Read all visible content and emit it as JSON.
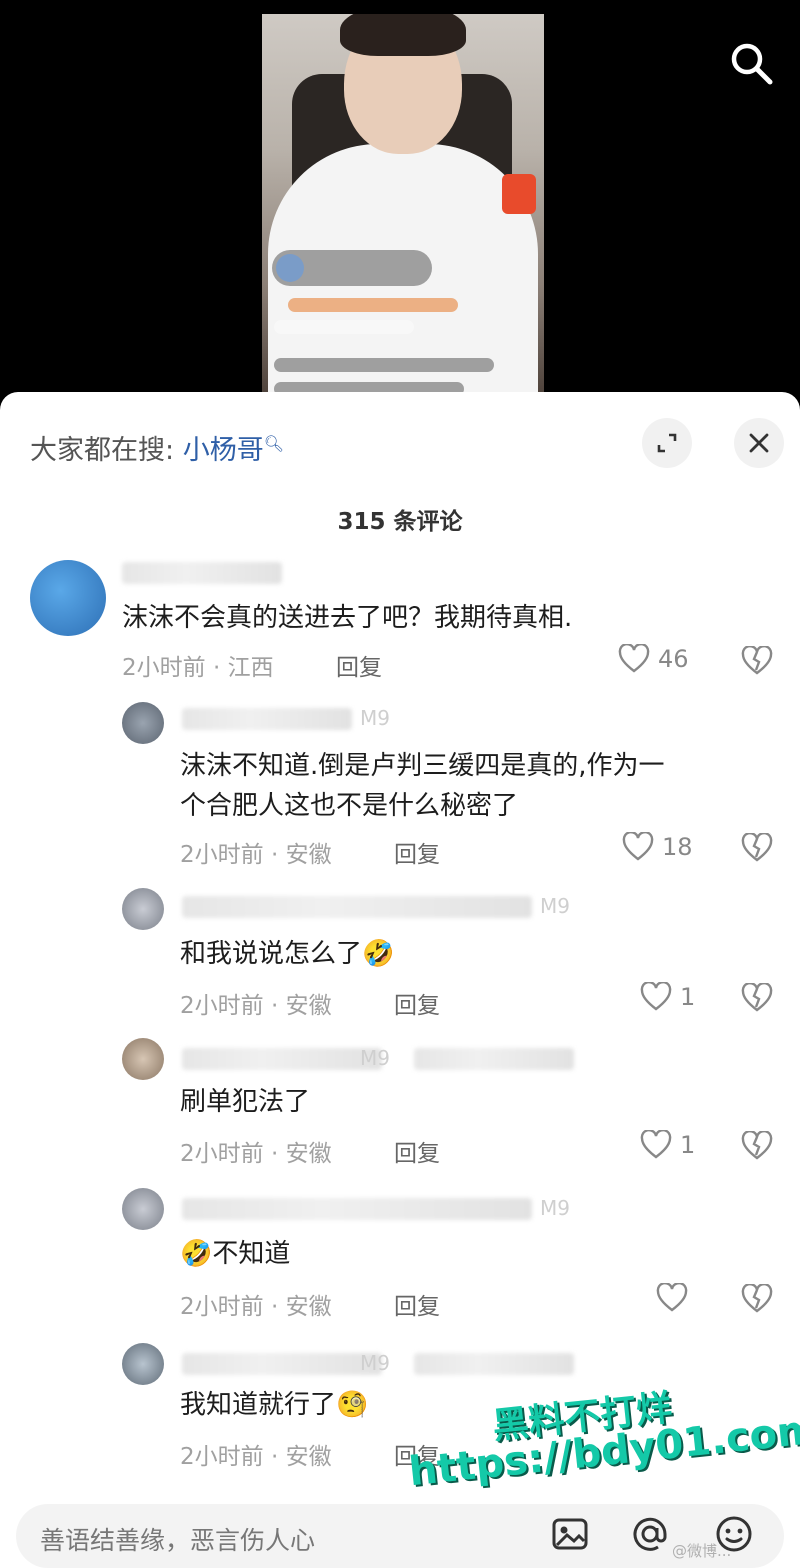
{
  "header": {
    "search_prefix": "大家都在搜:",
    "search_keyword": "小杨哥",
    "comment_count": "315 条评论"
  },
  "comments": [
    {
      "text": "沫沫不会真的送进去了吧？我期待真相.",
      "time": "2小时前 · 江西",
      "reply": "回复",
      "likes": "46"
    },
    {
      "text_line1": "沫沫不知道.倒是卢判三缓四是真的,作为一",
      "text_line2": "个合肥人这也不是什么秘密了",
      "time": "2小时前 · 安徽",
      "reply": "回复",
      "likes": "18",
      "name_suffix": "M9"
    },
    {
      "text": "和我说说怎么了",
      "emoji": "🤣",
      "time": "2小时前 · 安徽",
      "reply": "回复",
      "likes": "1",
      "name_suffix": "M9"
    },
    {
      "text": "刷单犯法了",
      "time": "2小时前 · 安徽",
      "reply": "回复",
      "likes": "1",
      "name_suffix": "M9"
    },
    {
      "emoji": "🤣",
      "text": "不知道",
      "time": "2小时前 · 安徽",
      "reply": "回复",
      "likes": "",
      "name_suffix": "M9"
    },
    {
      "text": "我知道就行了",
      "emoji": "🧐",
      "time": "2小时前 · 安徽",
      "reply": "回复",
      "likes": "",
      "name_suffix": "M9"
    }
  ],
  "input": {
    "placeholder": "善语结善缘，恶言伤人心"
  },
  "watermark": {
    "line1": "黑料不打烊",
    "line2": "https://bdy01.com",
    "line3": "@微博..."
  },
  "icons": {
    "search": "search-icon",
    "expand": "expand-icon",
    "close": "close-icon",
    "like": "heart-icon",
    "dislike": "broken-heart-icon",
    "image": "image-icon",
    "mention": "at-icon",
    "emoji": "emoji-icon"
  },
  "colors": {
    "accent": "#2f5fa7",
    "watermark": "#14c9a8"
  }
}
